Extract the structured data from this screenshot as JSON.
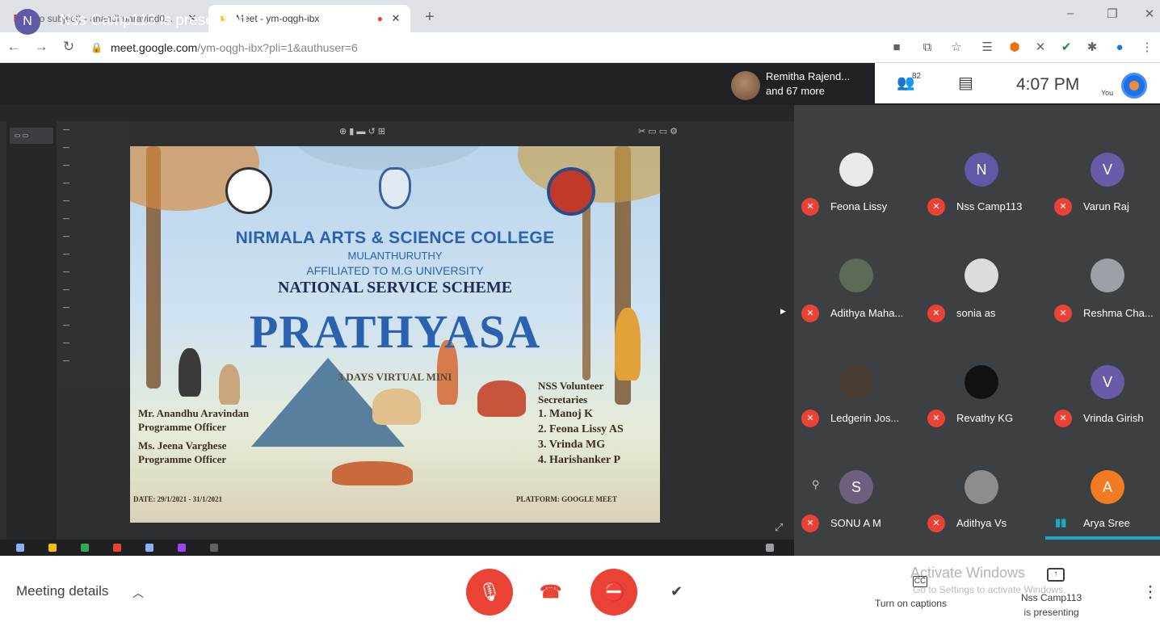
{
  "browser": {
    "tabs": [
      {
        "favicon": "gmail-icon",
        "title": "(no subject) - anandhuaravind0..."
      },
      {
        "favicon": "meet-icon",
        "title": "Meet - ym-oqgh-ibx",
        "recording": "●"
      }
    ],
    "new_tab": "+",
    "url_host": "meet.google.com",
    "url_path": "/ym-oqgh-ibx?pli=1&authuser=6"
  },
  "meet": {
    "header_avatar_letter": "N",
    "header_title": "Nss Camp113 is presenting",
    "others_line1": "Remitha Rajend...",
    "others_line2": "and 67 more",
    "participant_count": "82",
    "time": "4:07 PM",
    "you_label": "You"
  },
  "slide": {
    "college": "NIRMALA ARTS & SCIENCE COLLEGE",
    "place": "MULANTHURUTHY",
    "affiliation": "AFFILIATED TO M.G UNIVERSITY",
    "scheme": "NATIONAL SERVICE SCHEME",
    "event": "PRATHYASA",
    "event_sub": "3 DAYS VIRTUAL MINI",
    "officer1_name": "Mr. Anandhu Aravindan",
    "officer1_role": "Programme Officer",
    "officer2_name": "Ms. Jeena Varghese",
    "officer2_role": "Programme Officer",
    "volunteers_heading1": "NSS Volunteer",
    "volunteers_heading2": "Secretaries",
    "volunteers": [
      "1. Manoj K",
      "2. Feona Lissy AS",
      "3. Vrinda MG",
      "4. Harishanker P"
    ],
    "date": "DATE: 29/1/2021 - 31/1/2021",
    "platform": "PLATFORM: GOOGLE MEET"
  },
  "participants": [
    {
      "name": "Feona Lissy",
      "avatar": "photo"
    },
    {
      "name": "Nss Camp113",
      "avatar": "N",
      "color": "#5f59a8"
    },
    {
      "name": "Varun Raj",
      "avatar": "V",
      "color": "#6a5ba8"
    },
    {
      "name": "Adithya Maha...",
      "avatar": "photo"
    },
    {
      "name": "sonia as",
      "avatar": "photo"
    },
    {
      "name": "Reshma Cha...",
      "avatar": "photo"
    },
    {
      "name": "Ledgerin Jos...",
      "avatar": "photo"
    },
    {
      "name": "Revathy KG",
      "avatar": "photo"
    },
    {
      "name": "Vrinda Girish",
      "avatar": "V",
      "color": "#6a5ba8"
    },
    {
      "name": "SONU A M",
      "avatar": "S",
      "color": "#6d5f7d"
    },
    {
      "name": "Adithya Vs",
      "avatar": "photo"
    },
    {
      "name": "Arya Sree",
      "avatar": "A",
      "color": "#f37b21"
    }
  ],
  "controls": {
    "meeting_details": "Meeting details",
    "captions_icon": "CC",
    "captions_label": "Turn on captions",
    "presenting_line1": "Nss Camp113",
    "presenting_line2": "is presenting",
    "activate_windows": "Activate Windows",
    "activate_windows_sub": "Go to Settings to activate Windows."
  },
  "colors": {
    "meet_dark": "#202124",
    "tile_bg": "#3c4043",
    "red": "#ea4335",
    "accent": "#1a73e8"
  }
}
